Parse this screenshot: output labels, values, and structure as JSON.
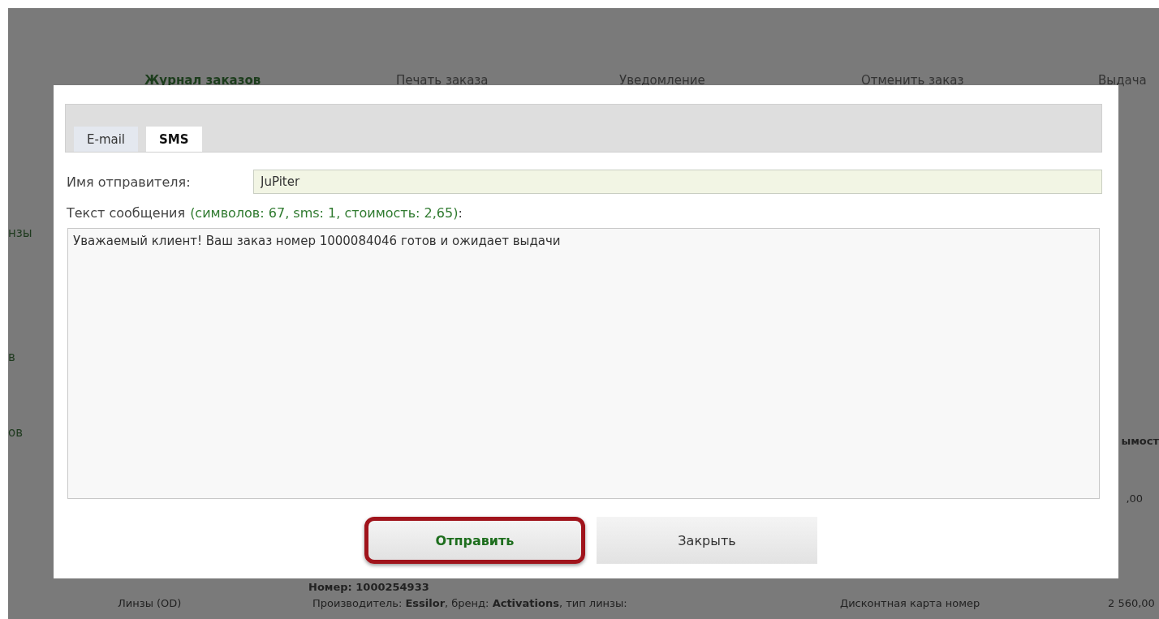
{
  "background": {
    "nav": [
      {
        "label": "Журнал заказов",
        "selected": true
      },
      {
        "label": "Печать заказа",
        "selected": false
      },
      {
        "label": "Уведомление",
        "selected": false
      },
      {
        "label": "Отменить заказ",
        "selected": false
      },
      {
        "label": "Выдача",
        "selected": false
      }
    ],
    "left_fragments": [
      "нзы",
      "в",
      "ов"
    ],
    "right_fragments": [
      "ымост",
      ",00"
    ],
    "order_number": "Номер: 1000254933",
    "row": {
      "item": "Линзы (OD)",
      "description": "Производитель: **Essilor**, бренд: **Activations**, тип линзы:",
      "discount": "Дисконтная карта номер",
      "price": "2 560,00"
    }
  },
  "dialog": {
    "tabs": [
      {
        "label": "E-mail",
        "selected": false
      },
      {
        "label": "SMS",
        "selected": true
      }
    ],
    "sender": {
      "label": "Имя отправителя:",
      "value": "JuPiter"
    },
    "message": {
      "label": "Текст сообщения",
      "counter": "(символов: 67, sms: 1, стоимость: 2,65)",
      "colon": ":",
      "value": "Уважаемый клиент! Ваш заказ номер 1000084046 готов и ожидает выдачи"
    },
    "buttons": [
      {
        "label": "Отправить",
        "kind": "primary",
        "highlighted": true
      },
      {
        "label": "Закрыть",
        "kind": "secondary",
        "highlighted": false
      }
    ]
  }
}
